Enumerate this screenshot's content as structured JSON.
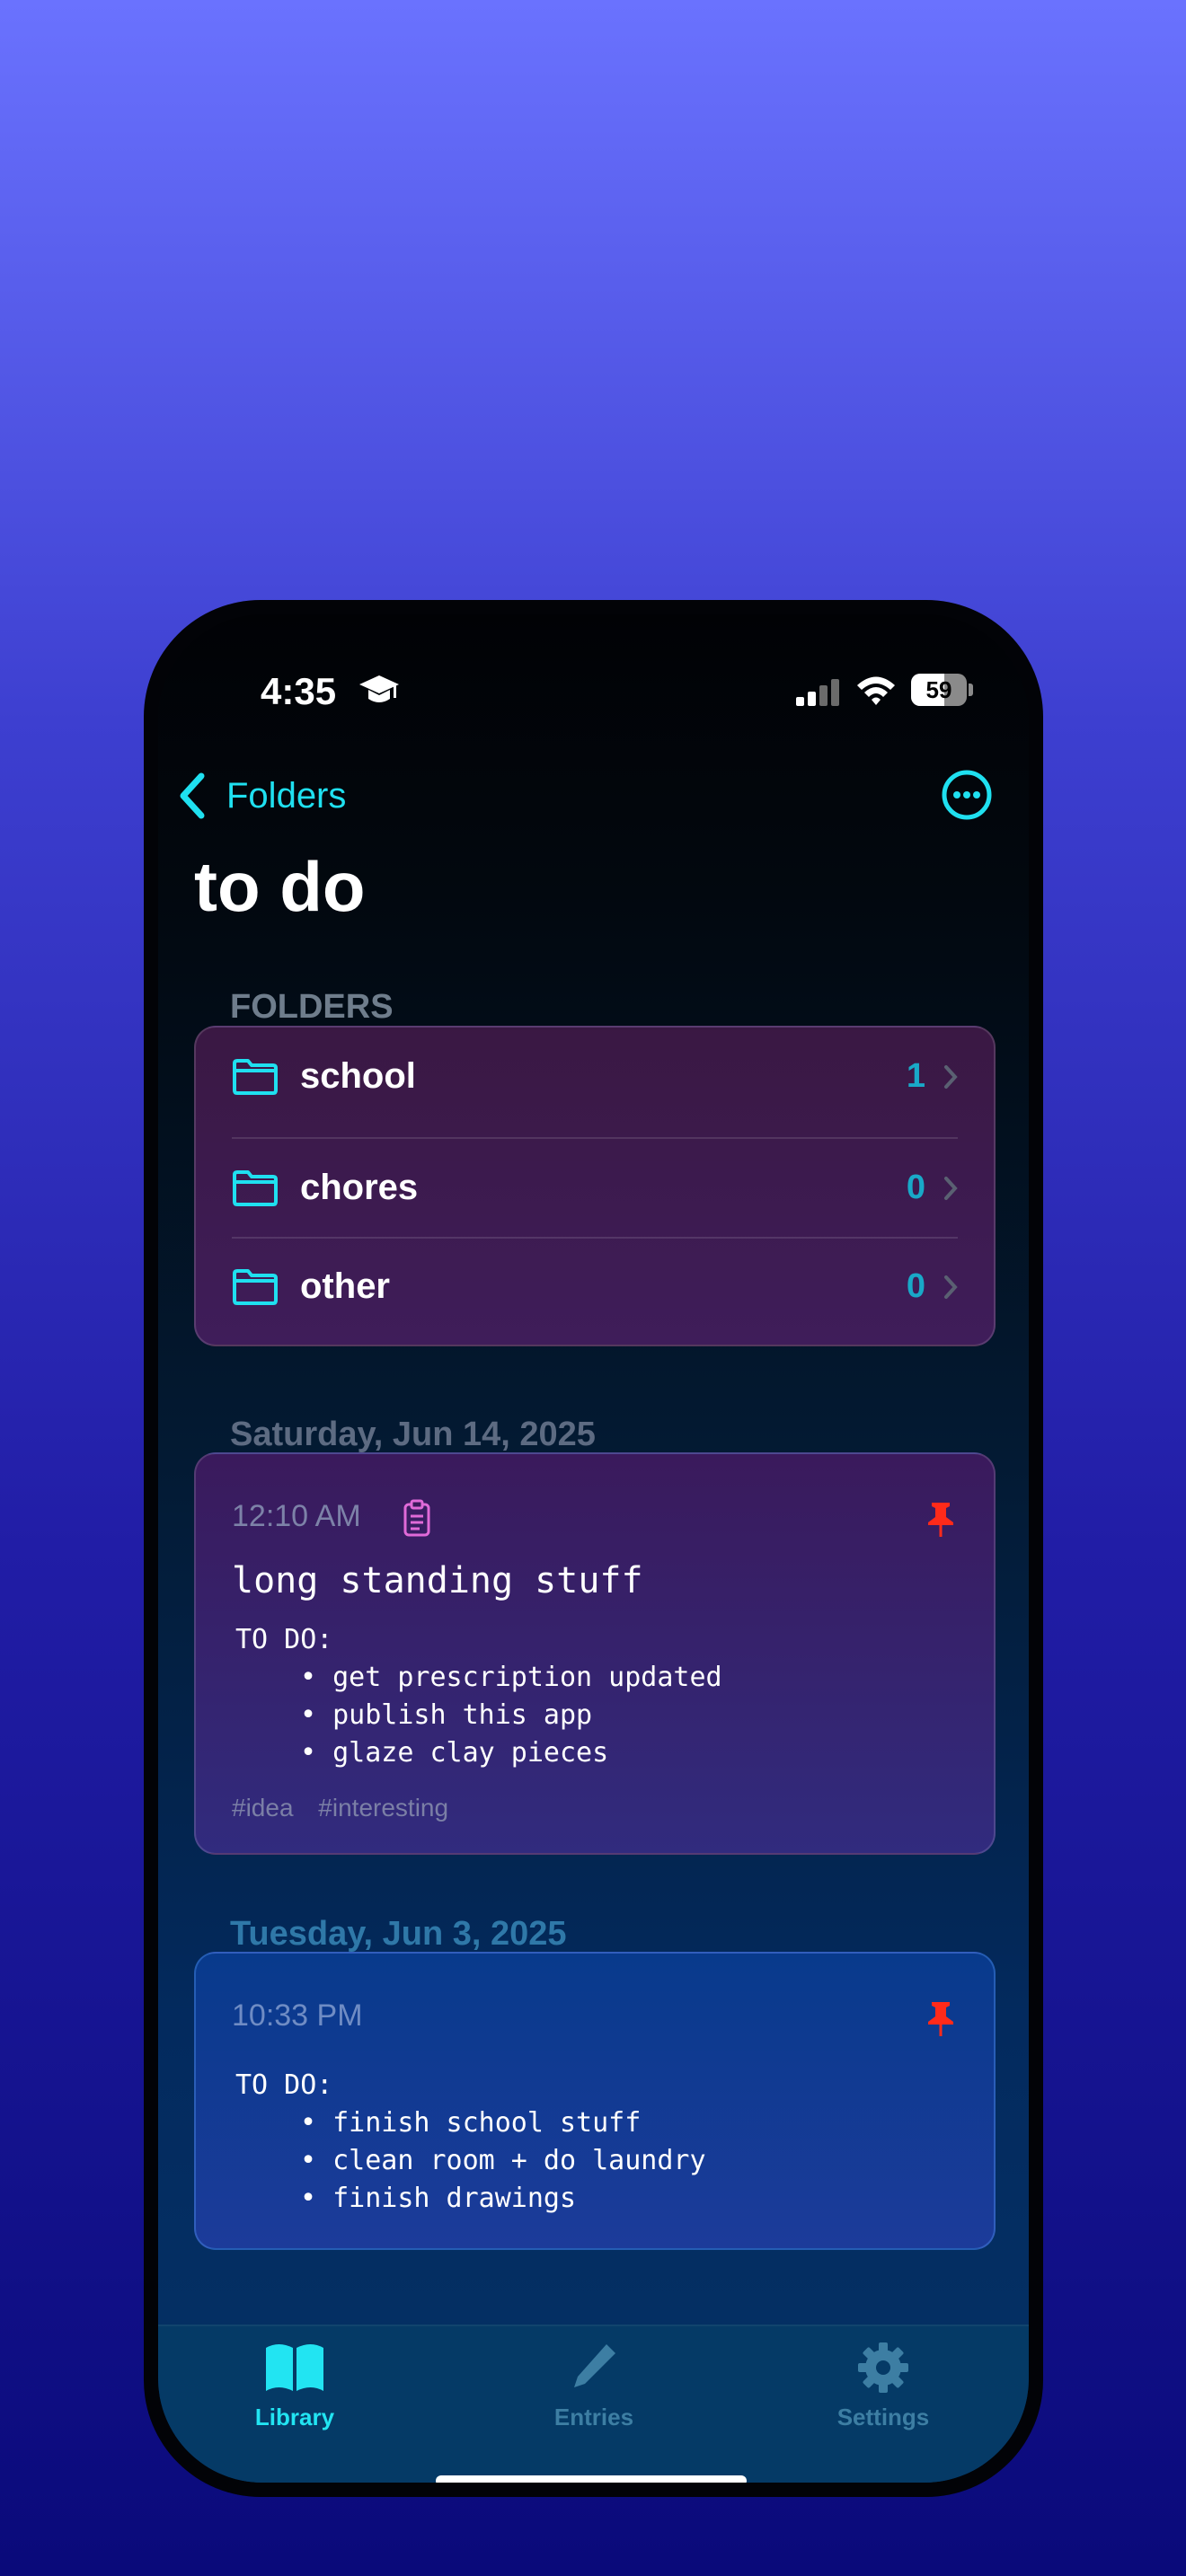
{
  "status_bar": {
    "time": "4:35",
    "battery": "59",
    "battery_level": 0.59,
    "icons": [
      "graduation-cap-icon",
      "cellular-signal-icon",
      "wifi-icon",
      "battery-icon"
    ]
  },
  "nav": {
    "back_label": "Folders",
    "more_icon": "ellipsis-circle-icon"
  },
  "page": {
    "title": "to do"
  },
  "folders": {
    "section_label": "FOLDERS",
    "items": [
      {
        "name": "school",
        "count": "1"
      },
      {
        "name": "chores",
        "count": "0"
      },
      {
        "name": "other",
        "count": "0"
      }
    ]
  },
  "entries": [
    {
      "date_label": "Saturday, Jun 14, 2025",
      "time": "12:10 AM",
      "title": "long standing stuff",
      "body_heading": "TO DO:",
      "bullets": [
        "get prescription updated",
        "publish this app",
        "glaze clay pieces"
      ],
      "tags": [
        "#idea",
        "#interesting"
      ],
      "pinned": true
    },
    {
      "date_label": "Tuesday, Jun 3, 2025",
      "time": "10:33 PM",
      "body_heading": "TO DO:",
      "bullets": [
        "finish school stuff",
        "clean room + do laundry",
        "finish drawings"
      ],
      "pinned": true
    }
  ],
  "tabbar": {
    "items": [
      {
        "label": "Library",
        "icon": "book-icon",
        "active": true
      },
      {
        "label": "Entries",
        "icon": "pencil-icon",
        "active": false
      },
      {
        "label": "Settings",
        "icon": "gear-icon",
        "active": false
      }
    ]
  },
  "colors": {
    "accent": "#22e4f2",
    "pin": "#ff2a1a",
    "count": "#19a9c8"
  }
}
